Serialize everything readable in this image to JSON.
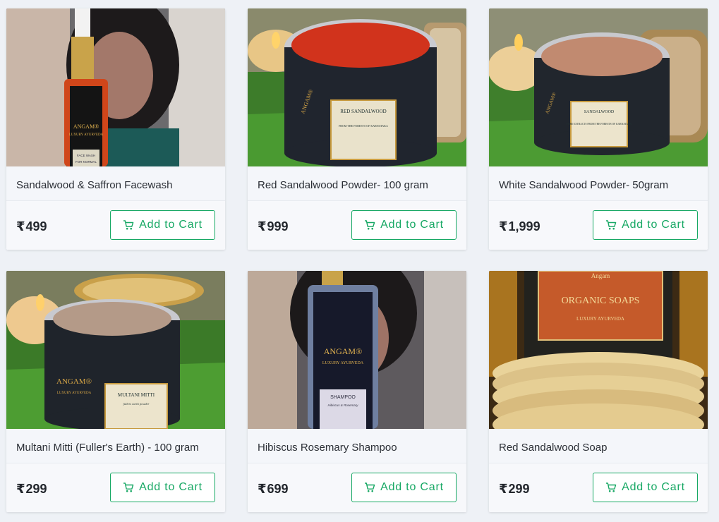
{
  "currency_symbol": "₹",
  "button_label": "Add to Cart",
  "accent_color": "#17a864",
  "products": [
    {
      "name": "Sandalwood & Saffron Facewash",
      "price": "499",
      "image": {
        "label_brand": "ANGAM®",
        "label_line": "LUXURY AYURVEDA",
        "label_product": "FACE WASH",
        "label_sub": "FOR NORMAL"
      }
    },
    {
      "name": "Red Sandalwood Powder- 100 gram",
      "price": "999",
      "image": {
        "label_brand": "ANGAM®",
        "label_product": "RED SANDALWOOD",
        "label_sub": "FROM THE FORESTS OF KARNATAKA"
      }
    },
    {
      "name": "White Sandalwood Powder- 50gram",
      "price": "1,999",
      "image": {
        "label_brand": "ANGAM®",
        "label_product": "SANDALWOOD",
        "label_sub": "PURE EXTRACTS FROM THE FORESTS OF KARNATAKA"
      }
    },
    {
      "name": "Multani Mitti (Fuller's Earth) - 100 gram",
      "price": "299",
      "image": {
        "label_brand": "ANGAM®",
        "label_line": "LUXURY AYURVEDA",
        "label_product": "MULTANI MITTI",
        "label_sub": "fullers earth powder"
      }
    },
    {
      "name": "Hibiscus Rosemary Shampoo",
      "price": "699",
      "image": {
        "label_brand": "ANGAM®",
        "label_line": "LUXURY AYURVEDA",
        "label_product": "SHAMPOO",
        "label_sub": "Hibiscus & Rosemary"
      }
    },
    {
      "name": "Red Sandalwood Soap",
      "price": "299",
      "image": {
        "label_brand": "Angam",
        "label_line": "ORGANIC SOAPS",
        "label_sub": "LUXURY AYURVEDA"
      }
    }
  ]
}
